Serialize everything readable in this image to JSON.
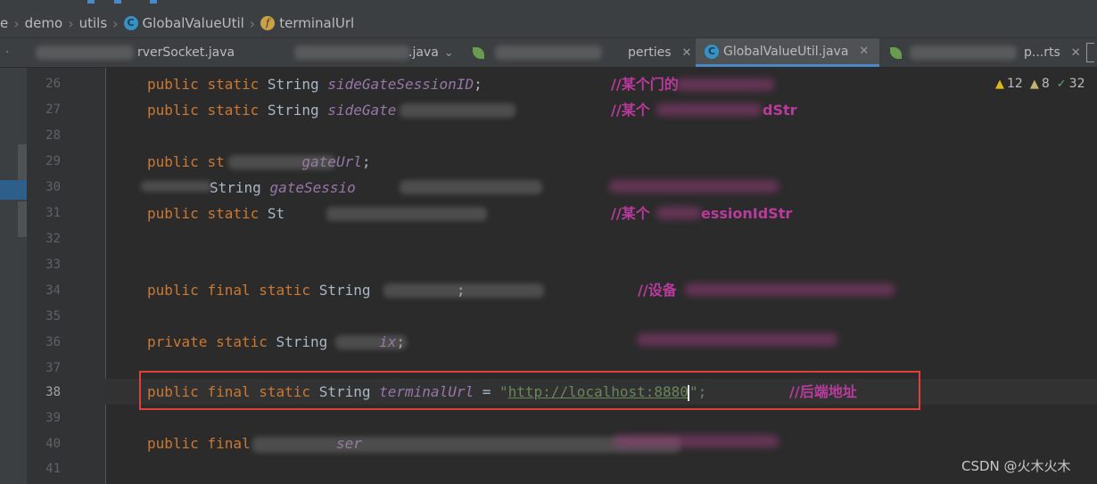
{
  "breadcrumb": {
    "items": [
      "e",
      "demo",
      "utils",
      "GlobalValueUtil",
      "terminalUrl"
    ]
  },
  "tabs": [
    {
      "label": "rverSocket.java",
      "active": false
    },
    {
      "label": ".java",
      "active": false
    },
    {
      "label": "perties",
      "active": false
    },
    {
      "label": "GlobalValueUtil.java",
      "active": true
    },
    {
      "label": "p...rts",
      "active": false
    }
  ],
  "inspections": {
    "warnings": "12",
    "weak_warnings": "8",
    "typos": "32"
  },
  "code": {
    "line_numbers": [
      "26",
      "27",
      "28",
      "29",
      "30",
      "31",
      "32",
      "33",
      "34",
      "35",
      "36",
      "37",
      "38",
      "39",
      "40",
      "41"
    ],
    "current_line": "38",
    "l26": {
      "kw1": "public",
      "kw2": "static",
      "type": "String",
      "field": "sideGateSessionID",
      "end": ";",
      "comment": "//某个门的"
    },
    "l27": {
      "kw1": "public",
      "kw2": "static",
      "type": "String",
      "field": "sideGate",
      "comment": "//某个",
      "comment_tail": "dStr"
    },
    "l29": {
      "kw1": "public",
      "kw2": "st",
      "field": "gateUrl",
      "end": ";"
    },
    "l30": {
      "type": "String",
      "field": "gateSessio"
    },
    "l31": {
      "kw1": "public",
      "kw2": "static",
      "type": "St",
      "comment": "//某个",
      "comment_tail": "essionIdStr"
    },
    "l34": {
      "kw1": "public",
      "kw2": "final",
      "kw3": "static",
      "type": "String",
      "end": ";",
      "comment": "//设备"
    },
    "l36": {
      "kw1": "private",
      "kw2": "static",
      "type": "String",
      "field": "ix",
      "end": ";"
    },
    "l38": {
      "kw1": "public",
      "kw2": "final",
      "kw3": "static",
      "type": "String",
      "field": "terminalUrl",
      "eq": " = ",
      "quote": "\"",
      "url": "http://localhost:8880",
      "end": "\";",
      "comment": "//后端地址"
    },
    "l40": {
      "kw1": "public",
      "kw2": "final",
      "field": "ser"
    }
  },
  "watermark": "CSDN @火木火木",
  "colors": {
    "keyword": "#cc7832",
    "field": "#9876aa",
    "string": "#6a8759",
    "comment": "#ba3a9e",
    "highlight_box": "#e0403a",
    "active_tab_underline": "#4a88c7"
  }
}
